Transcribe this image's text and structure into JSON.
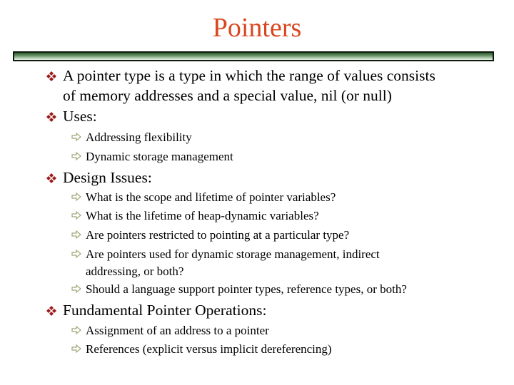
{
  "slide": {
    "title": "Pointers",
    "colors": {
      "title": "#d9471f",
      "bullet": "#9b1b1b",
      "sub_arrow": "#a2a676",
      "bar_dark": "#2f5a2f",
      "bar_light": "#e9f2e9",
      "text": "#000000"
    },
    "icons": {
      "level1_bullet": "four-diamond-bullet-icon",
      "level2_bullet": "hollow-right-arrow-icon"
    },
    "bullets": [
      {
        "lines": [
          "A pointer type is a type in which the range of values consists",
          "of memory addresses and a special value, nil (or null)"
        ],
        "subitems": []
      },
      {
        "lines": [
          "Uses:"
        ],
        "subitems": [
          {
            "lines": [
              "Addressing flexibility"
            ]
          },
          {
            "lines": [
              "Dynamic storage management"
            ]
          }
        ]
      },
      {
        "lines": [
          "Design Issues:"
        ],
        "subitems": [
          {
            "lines": [
              "What is the scope and lifetime of pointer variables?"
            ]
          },
          {
            "lines": [
              "What is the lifetime of heap-dynamic variables?"
            ]
          },
          {
            "lines": [
              "Are pointers restricted to pointing at a particular type?"
            ]
          },
          {
            "lines": [
              "Are pointers used for dynamic storage management, indirect",
              "addressing, or both?"
            ]
          },
          {
            "lines": [
              "Should a language support pointer types, reference types, or both?"
            ]
          }
        ]
      },
      {
        "lines": [
          "Fundamental Pointer Operations:"
        ],
        "subitems": [
          {
            "lines": [
              "Assignment of an address to a pointer"
            ]
          },
          {
            "lines": [
              "References (explicit versus implicit dereferencing)"
            ]
          }
        ]
      }
    ]
  }
}
